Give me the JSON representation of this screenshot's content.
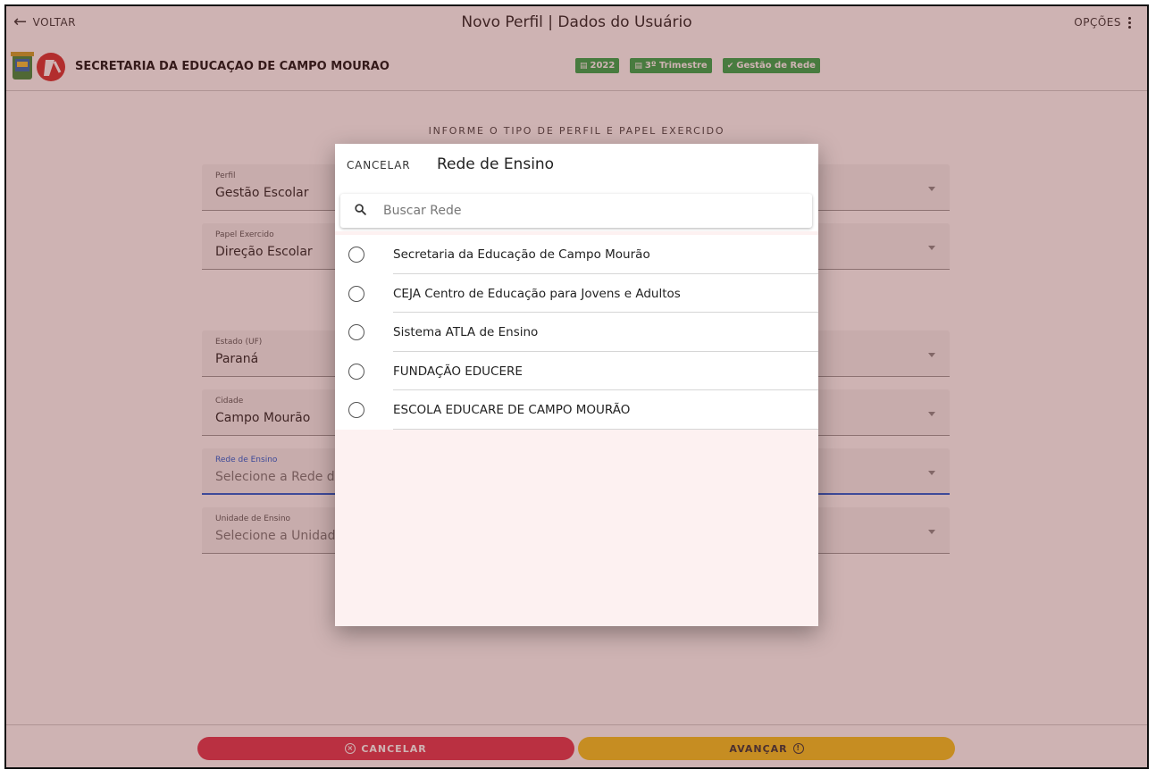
{
  "topbar": {
    "back_label": "VOLTAR",
    "title": "Novo Perfil | Dados do Usuário",
    "options_label": "OPÇÕES"
  },
  "org": {
    "name": "SECRETARIA DA EDUCAÇAO DE CAMPO MOURAO",
    "badges": [
      {
        "icon": "calendar-icon",
        "label": "2022"
      },
      {
        "icon": "calendar-icon",
        "label": "3º Trimestre"
      },
      {
        "icon": "check-circle-icon",
        "label": "Gestão de Rede"
      }
    ],
    "badge_color": "#2ea84a"
  },
  "form": {
    "section_title": "INFORME O TIPO DE PERFIL E PAPEL EXERCIDO",
    "fields": [
      {
        "label": "Perfil",
        "value": "Gestão Escolar"
      },
      {
        "label": "Papel Exercido",
        "value": "Direção Escolar"
      },
      {
        "label": "Estado (UF)",
        "value": "Paraná"
      },
      {
        "label": "Cidade",
        "value": "Campo Mourão"
      },
      {
        "label": "Rede de Ensino",
        "placeholder": "Selecione a Rede de Ensino"
      },
      {
        "label": "Unidade de Ensino",
        "placeholder": "Selecione a Unidade de Ensino"
      }
    ]
  },
  "footer": {
    "cancel_label": "CANCELAR",
    "next_label": "AVANÇAR",
    "cancel_color": "#e0334e",
    "next_color": "#f3c41d"
  },
  "modal": {
    "cancel_label": "CANCELAR",
    "title": "Rede de Ensino",
    "search_placeholder": "Buscar Rede",
    "options": [
      "Secretaria da Educação de Campo Mourão",
      "CEJA Centro de Educação para Jovens e Adultos",
      "Sistema ATLA de Ensino",
      "FUNDAÇÃO EDUCERE",
      "ESCOLA EDUCARE DE CAMPO MOURÃO"
    ]
  },
  "accent_color": "#1e5bd6"
}
